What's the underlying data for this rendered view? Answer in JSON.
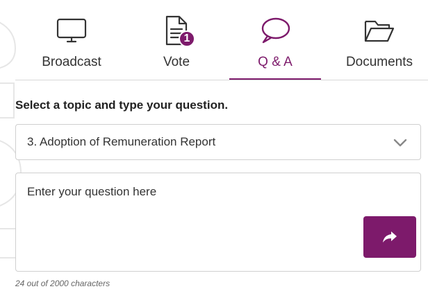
{
  "colors": {
    "accent": "#7d1a6b",
    "text": "#333333",
    "border": "#cfcfcf"
  },
  "tabs": [
    {
      "label": "Broadcast",
      "icon": "monitor-icon"
    },
    {
      "label": "Vote",
      "icon": "document-icon",
      "badge": "1"
    },
    {
      "label": "Q & A",
      "icon": "speech-bubble-icon",
      "active": true
    },
    {
      "label": "Documents",
      "icon": "folder-icon"
    }
  ],
  "form": {
    "prompt": "Select a topic and type your question.",
    "topic_selected": "3. Adoption of Remuneration Report",
    "question_placeholder": "Enter your question here",
    "char_count": "24 out of 2000 characters"
  }
}
